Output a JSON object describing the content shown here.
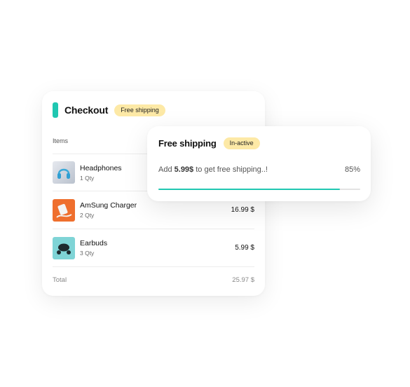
{
  "checkout": {
    "title": "Checkout",
    "badge": "Free shipping",
    "items_header": "Items",
    "items": [
      {
        "name": "Headphones",
        "qty": "1 Qty",
        "price": "",
        "icon": "headphones-image"
      },
      {
        "name": "AmSung Charger",
        "qty": "2 Qty",
        "price": "16.99 $",
        "icon": "charger-image"
      },
      {
        "name": "Earbuds",
        "qty": "3 Qty",
        "price": "5.99 $",
        "icon": "earbuds-image"
      }
    ],
    "total_label": "Total",
    "total_value": "25.97 $"
  },
  "shipping": {
    "title": "Free shipping",
    "badge": "In-active",
    "message_prefix": "Add ",
    "message_amount": "5.99$",
    "message_suffix": " to get free shipping..!",
    "percent_label": "85%",
    "progress": 0.9
  },
  "colors": {
    "accent": "#20c7b1",
    "badge_bg": "#fde9a6"
  }
}
